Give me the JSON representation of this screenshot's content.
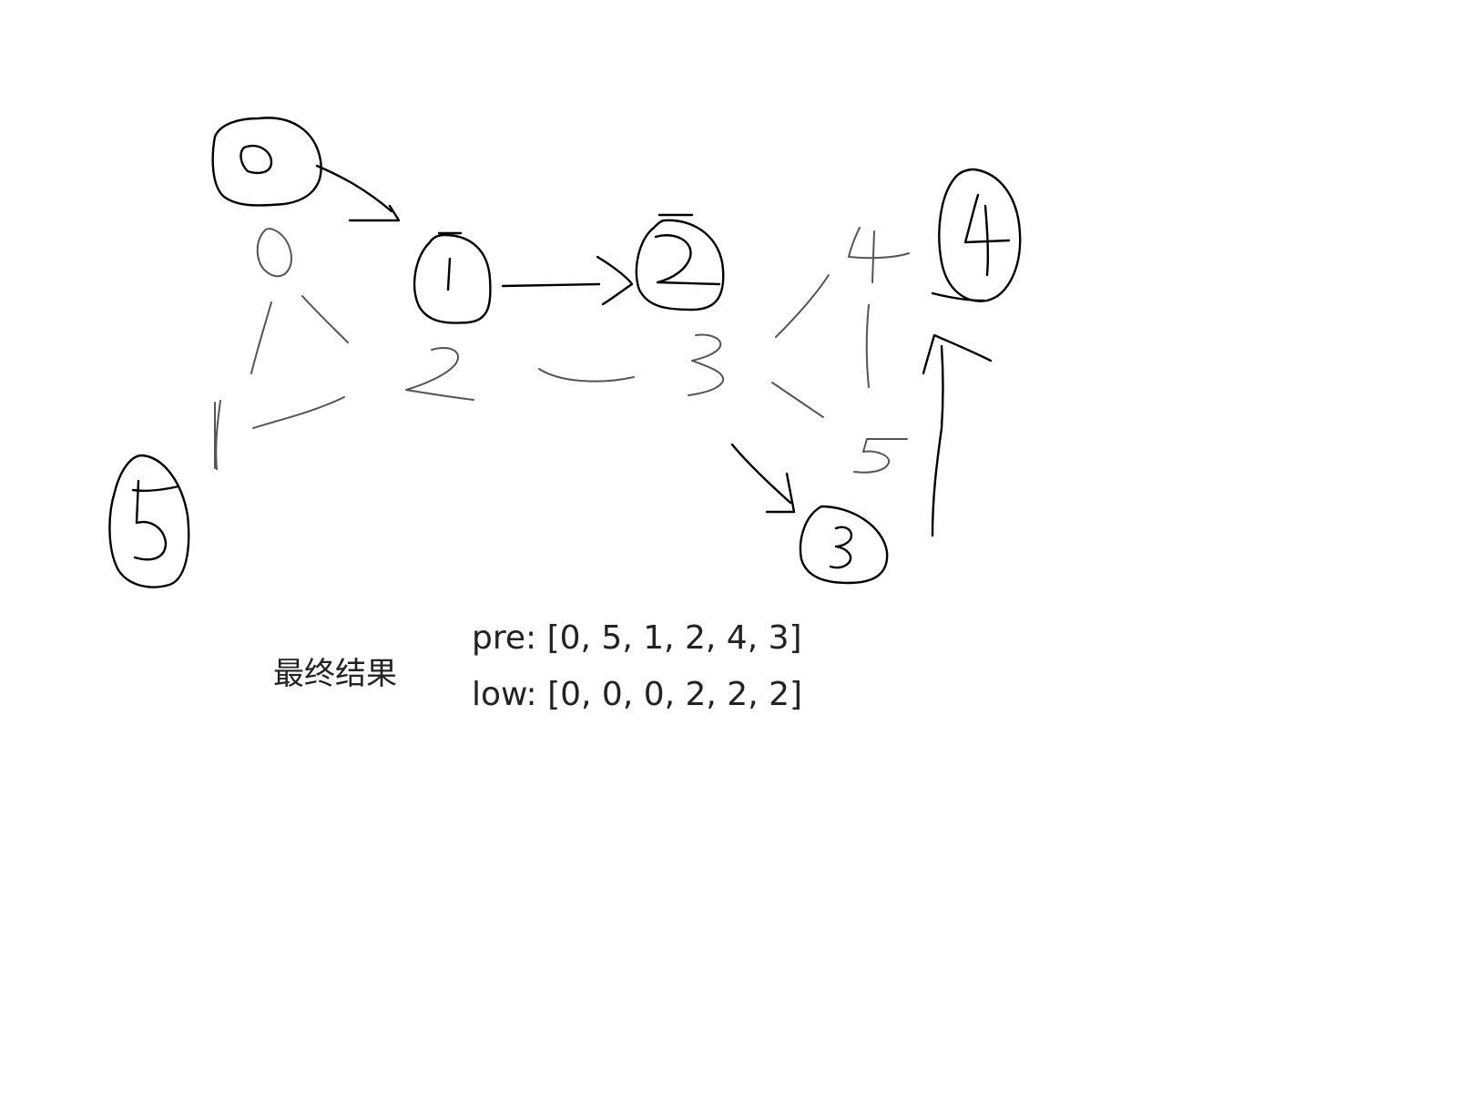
{
  "graph": {
    "nodes": [
      {
        "id": 0,
        "label": "0"
      },
      {
        "id": 1,
        "label": "1"
      },
      {
        "id": 2,
        "label": "2"
      },
      {
        "id": 3,
        "label": "3"
      },
      {
        "id": 4,
        "label": "4"
      },
      {
        "id": 5,
        "label": "5"
      }
    ],
    "order_labels": [
      "0",
      "1",
      "2",
      "3",
      "4",
      "5"
    ],
    "edges": [
      {
        "from": 0,
        "to": 1,
        "directed": true
      },
      {
        "from": 1,
        "to": 2,
        "directed": true
      },
      {
        "from": 2,
        "to": 3,
        "directed": true
      },
      {
        "from": 3,
        "to": 4,
        "directed": true
      }
    ]
  },
  "result": {
    "title": "最终结果",
    "pre": "pre: [0, 5, 1, 2, 4, 3]",
    "low": "low: [0, 0, 0, 2, 2, 2]"
  }
}
